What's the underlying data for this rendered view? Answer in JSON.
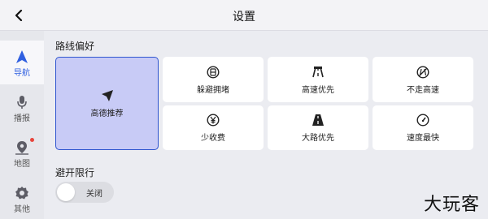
{
  "header": {
    "title": "设置",
    "back_icon": "chevron-left-icon"
  },
  "sidebar": {
    "items": [
      {
        "label": "导航",
        "icon": "navigation-arrow-icon",
        "active": true
      },
      {
        "label": "播报",
        "icon": "microphone-icon",
        "active": false
      },
      {
        "label": "地图",
        "icon": "map-pin-icon",
        "active": false,
        "badge": true
      },
      {
        "label": "其他",
        "icon": "gear-icon",
        "active": false
      }
    ]
  },
  "route_pref": {
    "title": "路线偏好",
    "options": [
      {
        "label": "高德推荐",
        "icon": "paper-plane-icon",
        "selected": true
      },
      {
        "label": "躲避拥堵",
        "icon": "congestion-avoid-icon",
        "selected": false
      },
      {
        "label": "高速优先",
        "icon": "highway-icon",
        "selected": false
      },
      {
        "label": "不走高速",
        "icon": "no-highway-icon",
        "selected": false
      },
      {
        "label": "少收费",
        "icon": "yuan-coin-icon",
        "selected": false
      },
      {
        "label": "大路优先",
        "icon": "main-road-icon",
        "selected": false
      },
      {
        "label": "速度最快",
        "icon": "speedometer-icon",
        "selected": false
      }
    ]
  },
  "restriction": {
    "title": "避开限行",
    "toggle_label": "关闭",
    "enabled": false
  },
  "watermark": "大玩客",
  "colors": {
    "accent": "#2f5fe0",
    "selected_bg": "#c8cbf6",
    "badge": "#e8453c"
  }
}
